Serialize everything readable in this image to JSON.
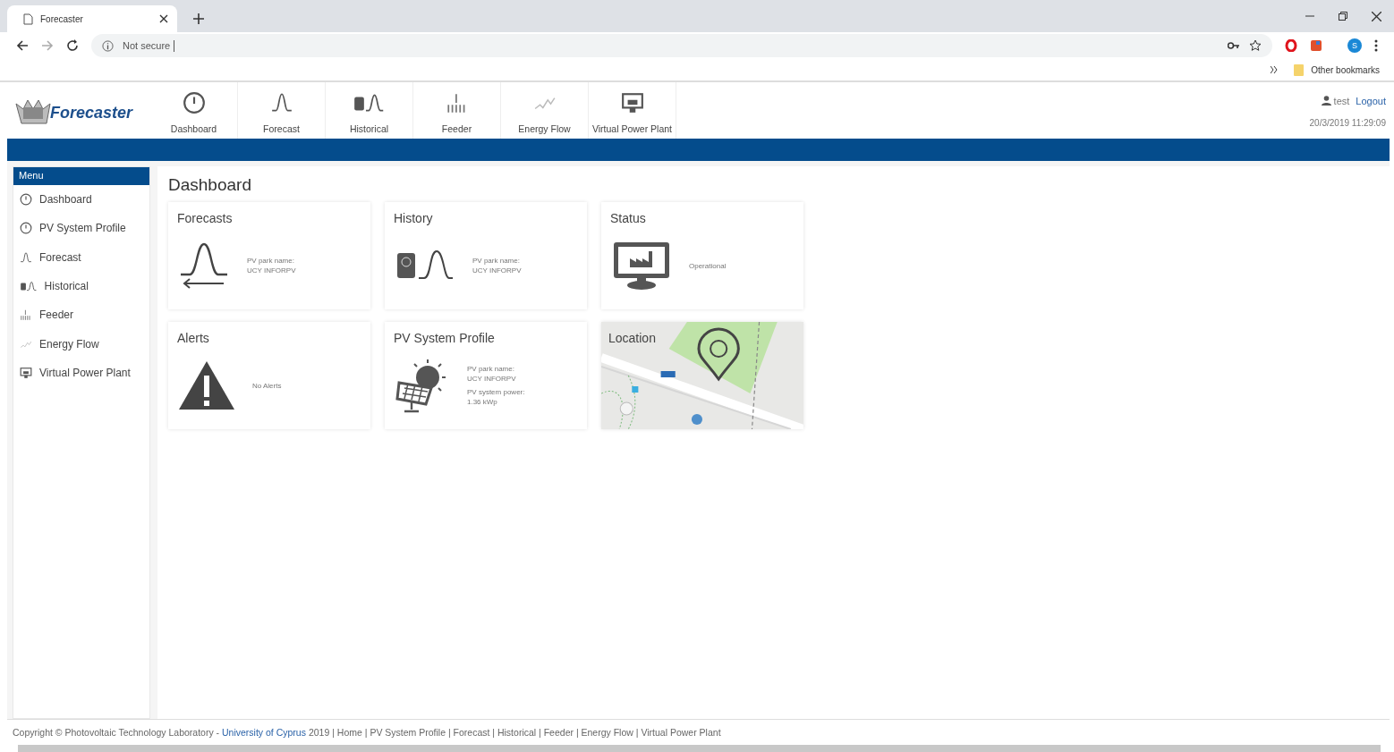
{
  "browser": {
    "tab_title": "Forecaster",
    "address": "Not secure",
    "bookmarks": "Other bookmarks",
    "profile": "S"
  },
  "header": {
    "logo_text": "Forecaster",
    "nav": [
      {
        "label": "Dashboard",
        "kind": "dashboard"
      },
      {
        "label": "Forecast",
        "kind": "forecast"
      },
      {
        "label": "Historical",
        "kind": "historical"
      },
      {
        "label": "Feeder",
        "kind": "feeder"
      },
      {
        "label": "Energy Flow",
        "kind": "flow"
      },
      {
        "label": "Virtual Power Plant",
        "kind": "vpp"
      }
    ],
    "user": "test",
    "logout": "Logout",
    "datetime": "20/3/2019 11:29:09"
  },
  "menu": {
    "title": "Menu",
    "items": [
      {
        "label": "Dashboard",
        "kind": "dashboard"
      },
      {
        "label": "PV System Profile",
        "kind": "dashboard"
      },
      {
        "label": "Forecast",
        "kind": "forecast"
      },
      {
        "label": "Historical",
        "kind": "historical"
      },
      {
        "label": "Feeder",
        "kind": "feeder"
      },
      {
        "label": "Energy Flow",
        "kind": "flow"
      },
      {
        "label": "Virtual Power Plant",
        "kind": "vpp"
      }
    ]
  },
  "page_title": "Dashboard",
  "cards": [
    {
      "title": "Forecasts",
      "kind": "forecast",
      "fields": [
        {
          "label": "PV park name:",
          "value": "UCY INFORPV"
        }
      ]
    },
    {
      "title": "History",
      "kind": "historical",
      "fields": [
        {
          "label": "PV park name:",
          "value": "UCY INFORPV"
        }
      ]
    },
    {
      "title": "Status",
      "kind": "status",
      "text": "Operational"
    },
    {
      "title": "Alerts",
      "kind": "alert",
      "text": "No Alerts"
    },
    {
      "title": "PV System Profile",
      "kind": "solar",
      "fields": [
        {
          "label": "PV park name:",
          "value": "UCY INFORPV"
        },
        {
          "label": "PV system power:",
          "value": "1.36 kWp"
        }
      ]
    },
    {
      "title": "Location",
      "kind": "map"
    }
  ],
  "footer": {
    "prefix": "Copyright © Photovoltaic Technology Laboratory -",
    "link": "University of Cyprus",
    "suffix": "2019 | Home | PV System Profile | Forecast | Historical | Feeder | Energy Flow | Virtual Power Plant"
  }
}
